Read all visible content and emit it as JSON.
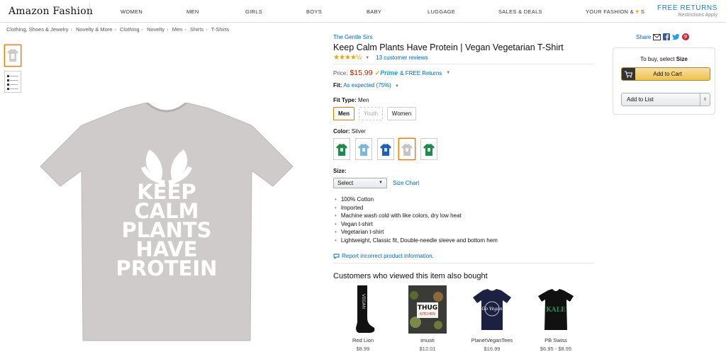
{
  "nav": {
    "logo": "Amazon Fashion",
    "items": [
      "WOMEN",
      "MEN",
      "GIRLS",
      "BOYS",
      "BABY",
      "LUGGAGE",
      "SALES & DEALS"
    ],
    "your_fashion": "YOUR FASHION &",
    "your_fashion_suffix": "S",
    "free_returns": "FREE RETURNS",
    "restrictions": "Restrictions Apply"
  },
  "breadcrumb": [
    "Clothing, Shoes & Jewelry",
    "Novelty & More",
    "Clothing",
    "Novelty",
    "Men",
    "Shirts",
    "T-Shirts"
  ],
  "product": {
    "brand": "The Gentle Sirs",
    "title": "Keep Calm Plants Have Protein | Vegan Vegetarian T-Shirt",
    "rating": 4.5,
    "stars": "★★★★½",
    "reviews": "13 customer reviews",
    "price_label": "Price:",
    "price": "$15.99",
    "prime": "Prime",
    "free_returns": "& FREE Returns",
    "fit_label": "Fit:",
    "fit_value": "As expected (75%)",
    "fit_type_label": "Fit Type:",
    "fit_type_value": "Men",
    "fit_options": [
      "Men",
      "Youth",
      "Women"
    ],
    "color_label": "Color:",
    "color_value": "Silver",
    "swatch_colors": [
      "#1f8a4c",
      "#7fb6dc",
      "#1f5fbf",
      "#c8c4c4",
      "#1f8a4c"
    ],
    "size_label": "Size:",
    "size_select": "Select",
    "size_chart": "Size Chart",
    "shirt_text": [
      "KEEP",
      "CALM",
      "PLANTS",
      "HAVE",
      "PROTEIN"
    ],
    "shirt_color": "#cfcbcb",
    "bullets": [
      "100% Cotton",
      "Imported",
      "Machine wash cold with like colors, dry low heat",
      "Vegan t-shirt",
      "Vegetarian t-shirt",
      "Lightweight, Classic fit, Double-needle sleeve and bottom hem"
    ],
    "report": "Report incorrect product information."
  },
  "share": {
    "label": "Share"
  },
  "buybox": {
    "to_buy": "To buy, select",
    "to_buy_bold": "Size",
    "add_to_cart": "Add to Cart",
    "add_to_list": "Add to List"
  },
  "also_bought": {
    "title": "Customers who viewed this item also bought",
    "items": [
      {
        "name": "Red Lion",
        "price": "$8.99",
        "icon": "sock-image"
      },
      {
        "name": "imusti",
        "price": "$12.01",
        "icon": "book-image",
        "cover_title": "THUG",
        "cover_subtitle": "KITCHEN"
      },
      {
        "name": "PlanetVeganTees",
        "price": "$16.99",
        "icon": "navy-shirt-image",
        "shirt_text": "Go Vegan"
      },
      {
        "name": "PB Swiss",
        "price": "$6.95 - $8.95",
        "icon": "black-shirt-image",
        "shirt_text": "KALE"
      }
    ]
  }
}
